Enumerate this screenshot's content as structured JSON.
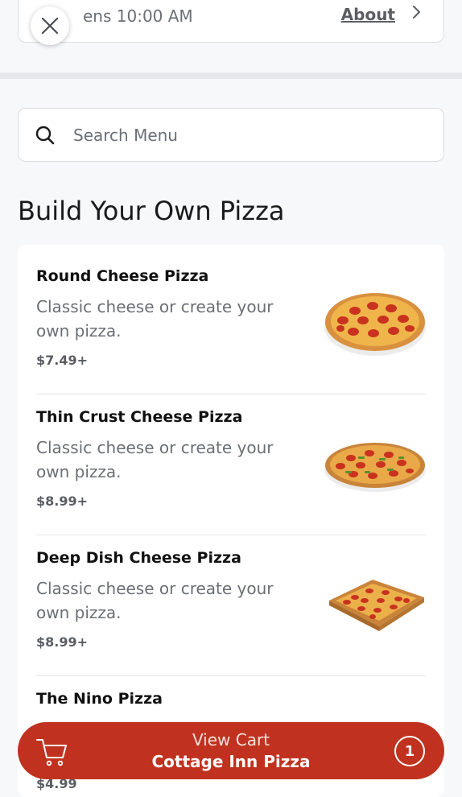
{
  "store_header": {
    "hours_text": "ens 10:00 AM",
    "about_label": "About"
  },
  "icons": {
    "close": "close-icon",
    "chevron": "chevron-right-icon",
    "search": "search-icon",
    "cart": "shopping-cart-icon"
  },
  "search": {
    "placeholder": "Search Menu",
    "value": ""
  },
  "section": {
    "title": "Build Your Own Pizza"
  },
  "menu_items": [
    {
      "name": "Round Cheese Pizza",
      "description": "Classic cheese or create your own pizza.",
      "price": "$7.49+"
    },
    {
      "name": "Thin Crust Cheese Pizza",
      "description": "Classic cheese or create your own pizza.",
      "price": "$8.99+"
    },
    {
      "name": "Deep Dish Cheese Pizza",
      "description": "Classic cheese or create your own pizza.",
      "price": "$8.99+"
    },
    {
      "name": "The Nino Pizza",
      "price": "$4.99"
    }
  ],
  "cart": {
    "label": "View Cart",
    "store_name": "Cottage Inn Pizza",
    "count": "1"
  },
  "colors": {
    "accent": "#c0321f",
    "text_muted": "#6b6f75",
    "background": "#f7f8fa"
  }
}
